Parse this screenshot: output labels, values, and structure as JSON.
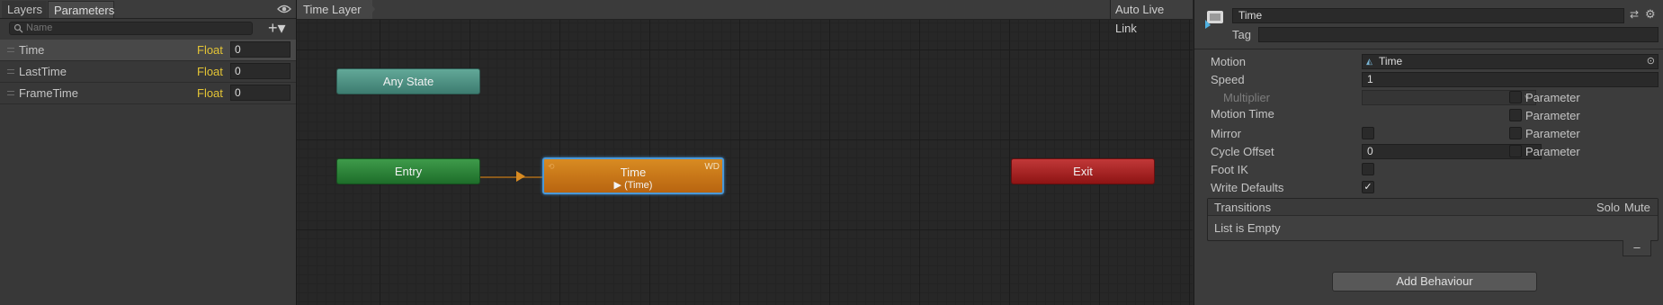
{
  "left_panel": {
    "tabs": [
      {
        "label": "Layers"
      },
      {
        "label": "Parameters"
      }
    ],
    "search": {
      "placeholder": "Name"
    },
    "add_label": "+▾",
    "parameters": [
      {
        "name": "Time",
        "type": "Float",
        "value": "0"
      },
      {
        "name": "LastTime",
        "type": "Float",
        "value": "0"
      },
      {
        "name": "FrameTime",
        "type": "Float",
        "value": "0"
      }
    ]
  },
  "graph": {
    "breadcrumb": "Time Layer",
    "auto_live_link": "Auto Live Link",
    "nodes": {
      "any_state": "Any State",
      "entry": "Entry",
      "exit": "Exit",
      "time": {
        "label": "Time",
        "motion": "▶ (Time)",
        "badge": "WD"
      }
    }
  },
  "inspector": {
    "state_name": "Time",
    "tag_label": "Tag",
    "tag_value": "",
    "fields": {
      "motion": {
        "label": "Motion",
        "value": "Time"
      },
      "speed": {
        "label": "Speed",
        "value": "1"
      },
      "multiplier": {
        "label": "Multiplier"
      },
      "motion_time": {
        "label": "Motion Time"
      },
      "mirror": {
        "label": "Mirror"
      },
      "cycle_offset": {
        "label": "Cycle Offset",
        "value": "0"
      },
      "foot_ik": {
        "label": "Foot IK"
      },
      "write_defaults": {
        "label": "Write Defaults",
        "checked": true
      }
    },
    "parameter_label": "Parameter",
    "transitions": {
      "title": "Transitions",
      "solo": "Solo",
      "mute": "Mute",
      "empty": "List is Empty"
    },
    "minus_label": "–",
    "add_behaviour": "Add Behaviour"
  }
}
